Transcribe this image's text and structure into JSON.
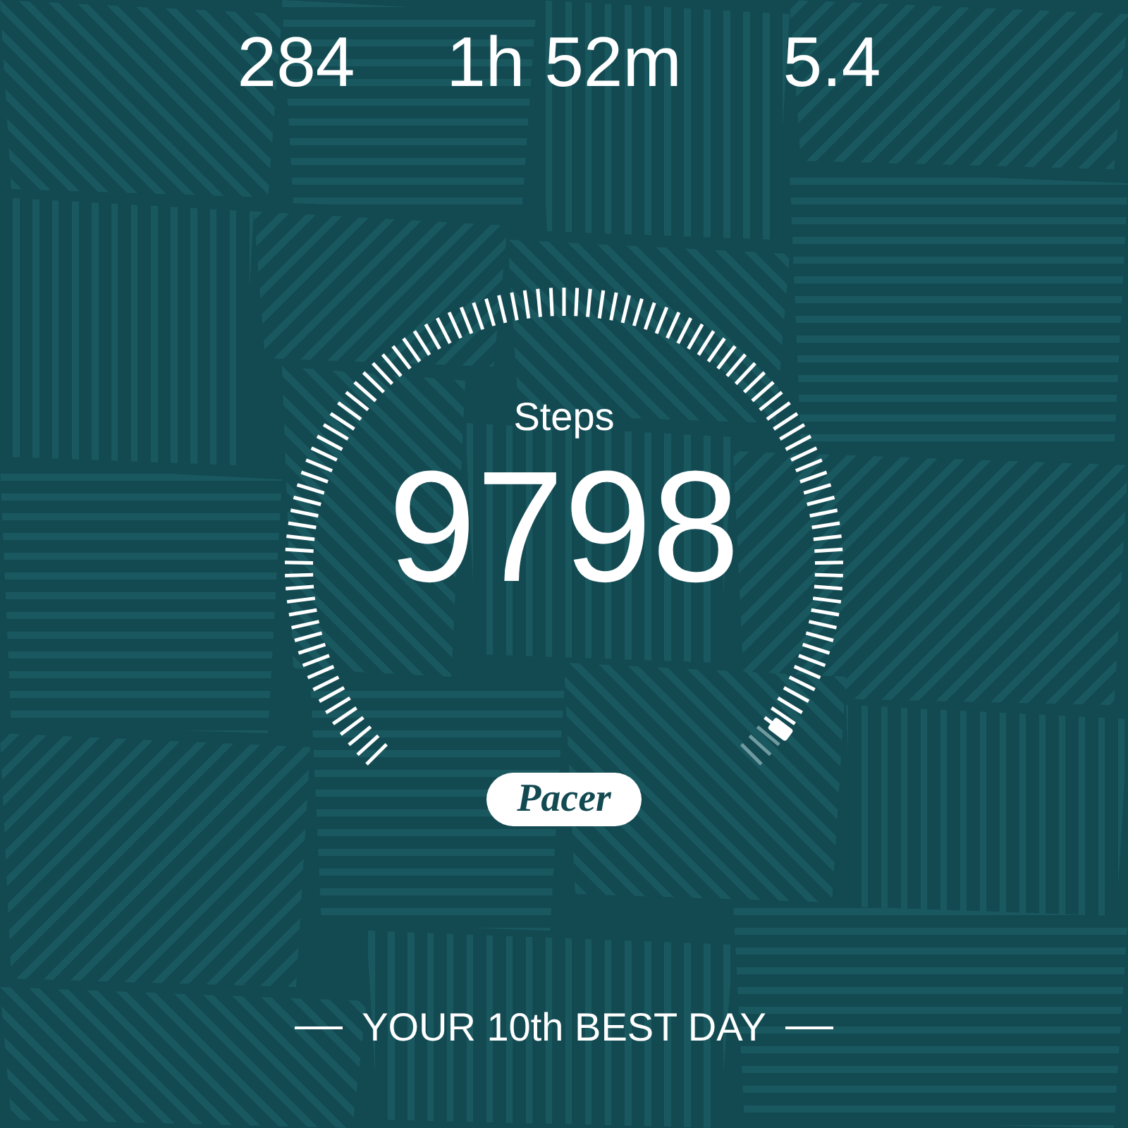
{
  "stats": [
    {
      "value": "284"
    },
    {
      "value": "1h 52m"
    },
    {
      "value": "5.4"
    }
  ],
  "steps": {
    "label": "Steps",
    "value": "9798"
  },
  "logo": "Pacer",
  "footer": "YOUR 10th BEST DAY"
}
